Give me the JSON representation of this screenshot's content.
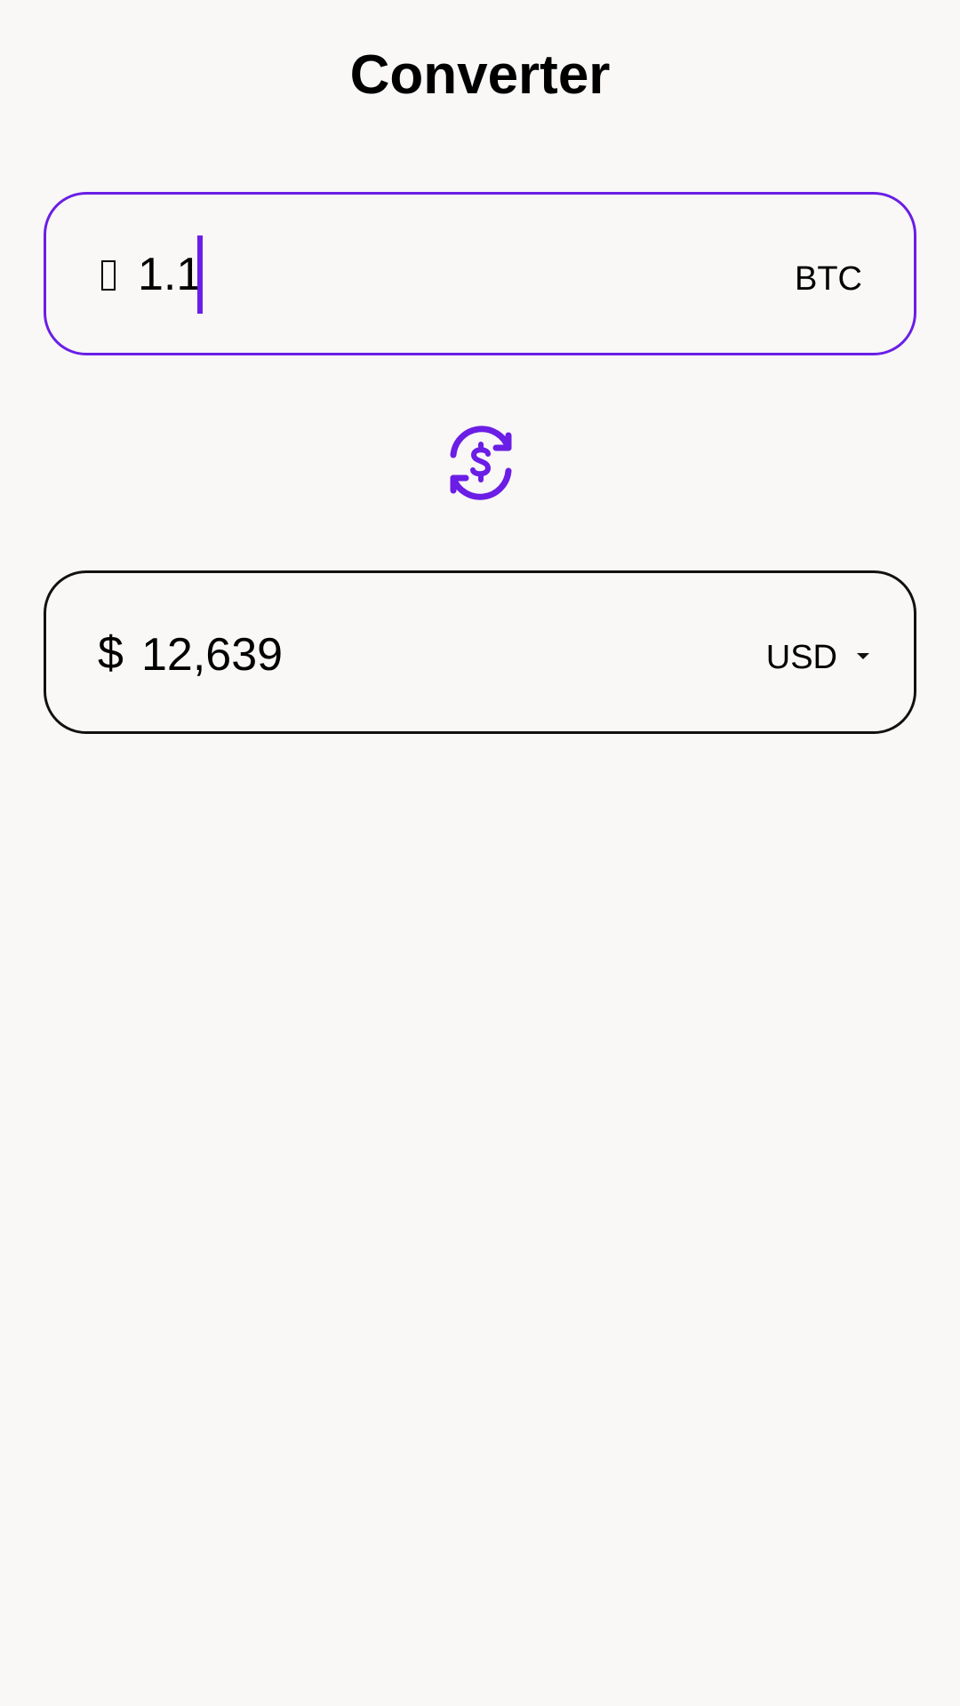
{
  "header": {
    "title": "Converter"
  },
  "from_field": {
    "prefix_symbol": "",
    "value": "1.1",
    "currency": "BTC"
  },
  "to_field": {
    "prefix_symbol": "$",
    "value": "12,639",
    "currency": "USD"
  },
  "colors": {
    "accent": "#6b1ee5",
    "background": "#f9f8f7",
    "text": "#000000"
  },
  "icons": {
    "swap": "currency-exchange-icon",
    "dropdown": "dropdown-arrow-icon"
  }
}
